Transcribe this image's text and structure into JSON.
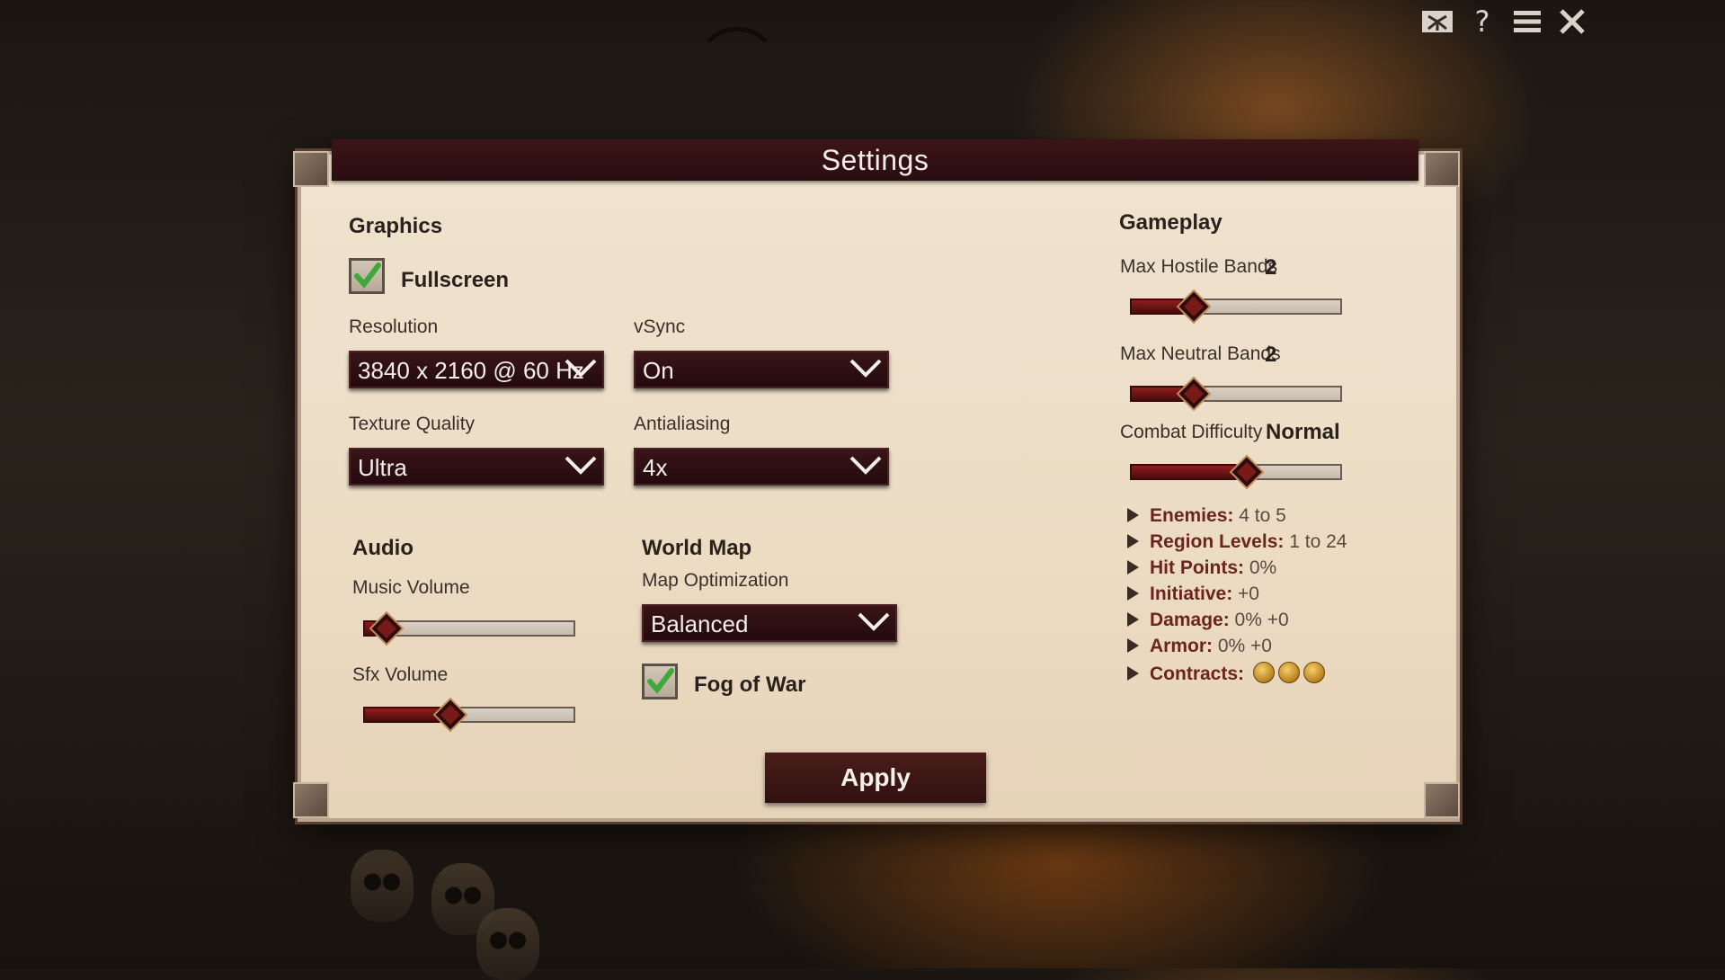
{
  "window": {
    "title": "Settings"
  },
  "topbar": {
    "icons": [
      "flag-icon",
      "help-icon",
      "menu-icon",
      "close-icon"
    ],
    "help_glyph": "?"
  },
  "graphics": {
    "heading": "Graphics",
    "fullscreen": {
      "label": "Fullscreen",
      "checked": true
    },
    "resolution": {
      "label": "Resolution",
      "value": "3840 x 2160 @ 60 Hz"
    },
    "vsync": {
      "label": "vSync",
      "value": "On"
    },
    "texture_quality": {
      "label": "Texture Quality",
      "value": "Ultra"
    },
    "antialiasing": {
      "label": "Antialiasing",
      "value": "4x"
    }
  },
  "audio": {
    "heading": "Audio",
    "music_volume": {
      "label": "Music Volume",
      "level": 0.06
    },
    "sfx_volume": {
      "label": "Sfx Volume",
      "level": 0.36
    }
  },
  "world_map": {
    "heading": "World Map",
    "map_optimization": {
      "label": "Map Optimization",
      "value": "Balanced"
    },
    "fog_of_war": {
      "label": "Fog of War",
      "checked": true
    }
  },
  "gameplay": {
    "heading": "Gameplay",
    "max_hostile_bands": {
      "label": "Max Hostile Bands",
      "value": "2",
      "level": 0.25
    },
    "max_neutral_bands": {
      "label": "Max Neutral Bands",
      "value": "2",
      "level": 0.25
    },
    "combat_difficulty": {
      "label": "Combat Difficulty",
      "value": "Normal",
      "level": 0.5
    },
    "details": [
      {
        "key": "Enemies:",
        "value": "4 to 5"
      },
      {
        "key": "Region Levels:",
        "value": "1 to 24"
      },
      {
        "key": "Hit Points:",
        "value": "0%"
      },
      {
        "key": "Initiative:",
        "value": "+0"
      },
      {
        "key": "Damage:",
        "value": "0% +0"
      },
      {
        "key": "Armor:",
        "value": "0% +0"
      },
      {
        "key": "Contracts:",
        "value": ""
      }
    ],
    "contracts_coins": 3
  },
  "actions": {
    "apply_label": "Apply"
  },
  "colors": {
    "panel": "#ecdcc4",
    "accent": "#3a1517",
    "slider_fill": "#8e1d1b",
    "check": "#3fa83a"
  }
}
